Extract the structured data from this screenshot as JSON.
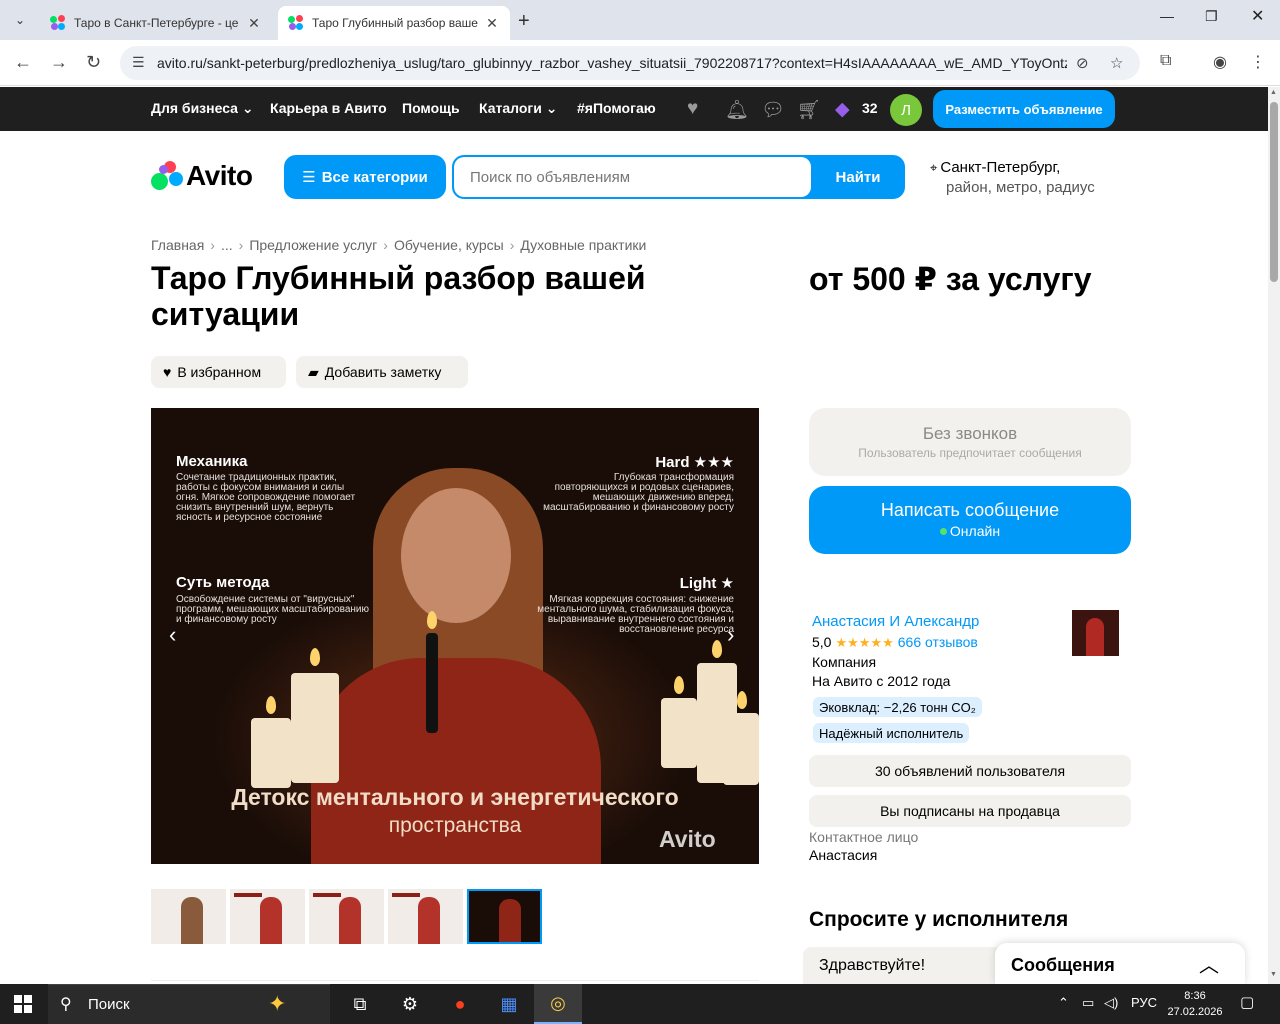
{
  "browser": {
    "tabs": [
      {
        "title": "Таро в Санкт-Петербурге - це",
        "active": false
      },
      {
        "title": "Таро Глубинный разбор ваше",
        "active": true
      }
    ],
    "url": "avito.ru/sankt-peterburg/predlozheniya_uslug/taro_glubinnyy_razbor_vashey_situatsii_7902208717?context=H4sIAAAAAAAA_wE_AMD_YToyOntz..."
  },
  "topnav": {
    "items": [
      "Для бизнеса",
      "Карьера в Авито",
      "Помощь",
      "Каталоги",
      "#яПомогаю"
    ],
    "bonus_count": "32",
    "avatar_letter": "Л",
    "post_button": "Разместить объявление"
  },
  "header": {
    "logo_text": "Avito",
    "categories_button": "Все категории",
    "search_placeholder": "Поиск по объявлениям",
    "search_button": "Найти",
    "location_city": "Санкт-Петербург,",
    "location_sub": "район, метро, радиус"
  },
  "breadcrumbs": [
    "Главная",
    "...",
    "Предложение услуг",
    "Обучение, курсы",
    "Духовные практики"
  ],
  "listing": {
    "title": "Таро Глубинный разбор вашей ситуации",
    "price": "от 500 ₽ за услугу",
    "favorite_button": "В избранном",
    "note_button": "Добавить заметку"
  },
  "gallery": {
    "image_texts": {
      "mechanics_title": "Механика",
      "mechanics_text": "Сочетание традиционных практик, работы с фокусом внимания и силы огня. Мягкое сопровождение помогает снизить внутренний шум, вернуть ясность и ресурсное состояние",
      "hard_title": "Hard ★★★",
      "hard_text": "Глубокая трансформация повторяющихся и родовых сценариев, мешающих движению вперед, масштабированию и финансовому росту",
      "method_title": "Суть метода",
      "method_text": "Освобождение системы от \"вирусных\" программ, мешающих масштабированию и финансовому росту",
      "light_title": "Light ★",
      "light_text": "Мягкая коррекция состояния: снижение ментального шума, стабилизация фокуса, выравнивание внутреннего состояния и восстановление ресурса",
      "headline_1": "Детокс ментального и энергетического",
      "headline_2": "пространства",
      "watermark": "Avito"
    },
    "thumbnail_count": 5,
    "selected_thumbnail": 5
  },
  "contact": {
    "no_calls_title": "Без звонков",
    "no_calls_sub": "Пользователь предпочитает сообщения",
    "message_button": "Написать сообщение",
    "online_status": "Онлайн"
  },
  "seller": {
    "name": "Анастасия И Александр",
    "rating": "5,0",
    "stars": 5,
    "reviews": "666 отзывов",
    "type": "Компания",
    "since": "На Авито с 2012 года",
    "badges": [
      "Эковклад: −2,26 тонн CO₂",
      "Надёжный исполнитель"
    ],
    "ads_button": "30 объявлений пользователя",
    "subscribed_button": "Вы подписаны на продавца",
    "contact_label": "Контактное лицо",
    "contact_name": "Анастасия"
  },
  "ask": {
    "title": "Спросите у исполнителя",
    "quick_reply": "Здравствуйте!"
  },
  "messages_panel": {
    "title": "Сообщения"
  },
  "taskbar": {
    "search_label": "Поиск",
    "lang": "РУС",
    "time": "8:36",
    "date": "27.02.2026"
  },
  "colors": {
    "accent_blue": "#0099f7",
    "topbar": "#1f1f1f",
    "chip_bg": "#f2f1ed",
    "star": "#ffb021"
  }
}
